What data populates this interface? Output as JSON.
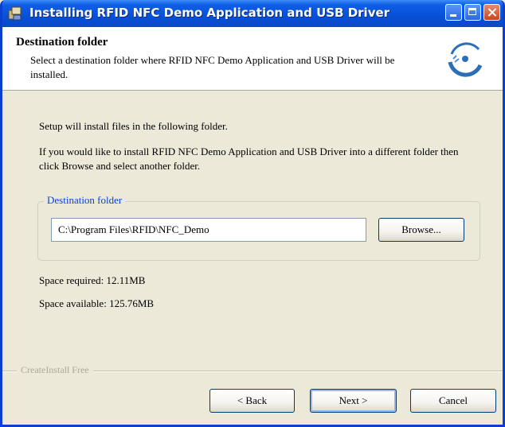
{
  "window": {
    "title": "Installing RFID NFC Demo Application and USB Driver"
  },
  "header": {
    "title": "Destination folder",
    "description": "Select a destination folder where RFID NFC Demo Application and USB Driver will be installed."
  },
  "body": {
    "intro": "Setup will install files in the following folder.",
    "instructions": "If you would like to install RFID NFC Demo Application and USB Driver into a different folder then click Browse and select another folder."
  },
  "destination": {
    "group_label": "Destination folder",
    "path": "C:\\Program Files\\RFID\\NFC_Demo",
    "browse_label": "Browse..."
  },
  "space": {
    "required": "Space required: 12.11MB",
    "available": "Space available: 125.76MB"
  },
  "footer": {
    "brand": "CreateInstall Free",
    "back_label": "< Back",
    "next_label": "Next >",
    "cancel_label": "Cancel"
  }
}
